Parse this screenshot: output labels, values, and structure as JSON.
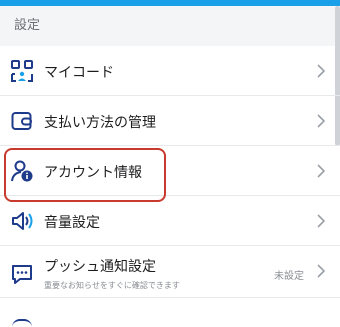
{
  "header": {
    "section_title": "設定"
  },
  "rows": [
    {
      "label": "マイコード",
      "icon": "qr-code-icon"
    },
    {
      "label": "支払い方法の管理",
      "icon": "wallet-icon"
    },
    {
      "label": "アカウント情報",
      "icon": "user-info-icon"
    },
    {
      "label": "音量設定",
      "icon": "speaker-icon"
    },
    {
      "label": "プッシュ通知設定",
      "sublabel": "重要なお知らせをすぐに確認できます",
      "value": "未設定",
      "icon": "chat-bubble-icon"
    }
  ],
  "colors": {
    "accent": "#1aa0e8",
    "icon": "#1e3a8a",
    "annotation": "#c83a2d"
  }
}
